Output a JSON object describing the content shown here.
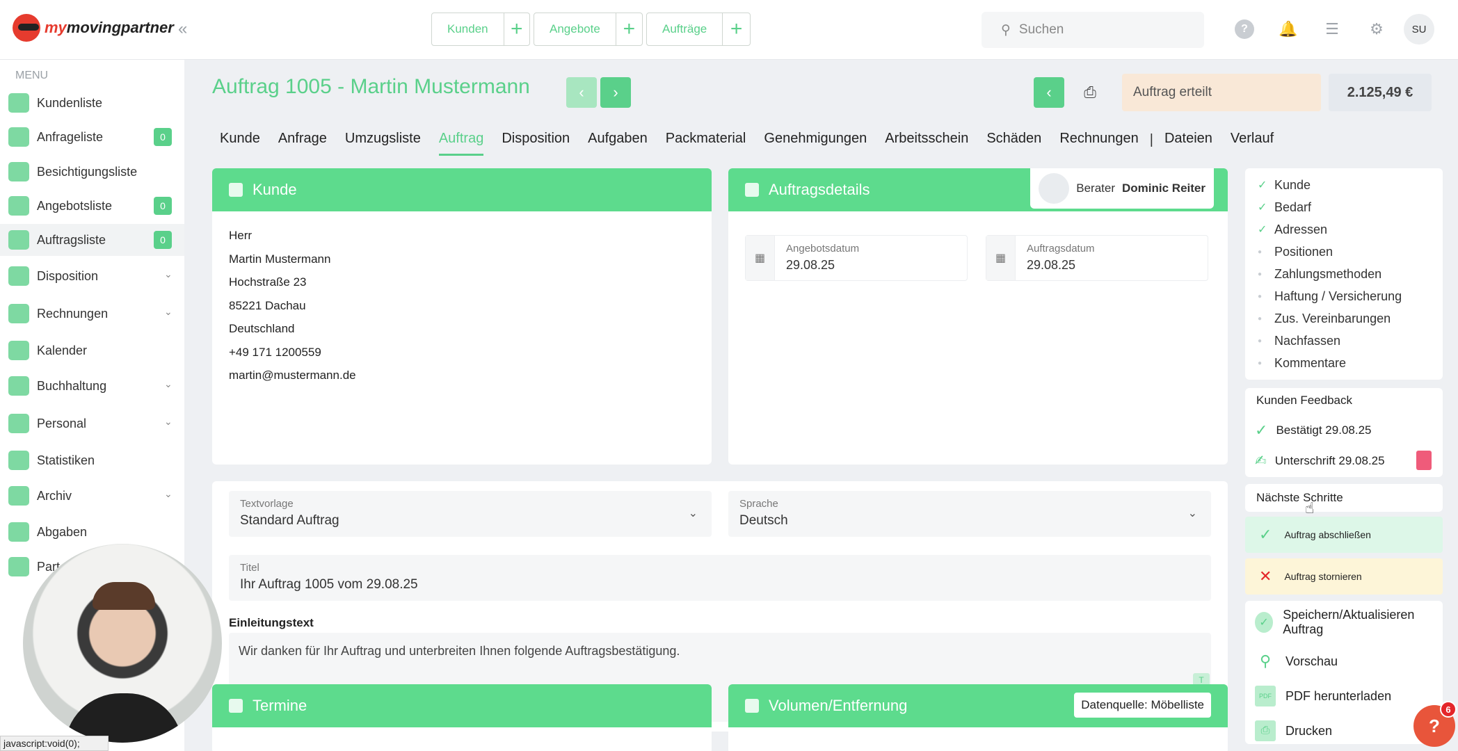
{
  "app": {
    "logo_text_a": "my",
    "logo_text_b": "movingpartner"
  },
  "quick": [
    {
      "label": "Kunden"
    },
    {
      "label": "Angebote"
    },
    {
      "label": "Aufträge"
    }
  ],
  "search": {
    "placeholder": "Suchen"
  },
  "user": {
    "initials": "SU"
  },
  "menu": {
    "heading": "MENU",
    "items": [
      {
        "label": "Kundenliste"
      },
      {
        "label": "Anfrageliste",
        "badge": "0"
      },
      {
        "label": "Besichtigungsliste"
      },
      {
        "label": "Angebotsliste",
        "badge": "0"
      },
      {
        "label": "Auftragsliste",
        "badge": "0"
      },
      {
        "label": "Disposition"
      },
      {
        "label": "Rechnungen"
      },
      {
        "label": "Kalender"
      },
      {
        "label": "Buchhaltung"
      },
      {
        "label": "Personal"
      },
      {
        "label": "Statistiken"
      },
      {
        "label": "Archiv"
      },
      {
        "label": "Abgaben"
      },
      {
        "label": "Part"
      }
    ]
  },
  "header": {
    "title": "Auftrag 1005 - Martin Mustermann",
    "status": "Auftrag erteilt",
    "amount": "2.125,49 €"
  },
  "tabs": [
    "Kunde",
    "Anfrage",
    "Umzugsliste",
    "Auftrag",
    "Disposition",
    "Aufgaben",
    "Packmaterial",
    "Genehmigungen",
    "Arbeitsschein",
    "Schäden",
    "Rechnungen",
    "Dateien",
    "Verlauf"
  ],
  "kunde": {
    "title": "Kunde",
    "lines": [
      "Herr",
      "Martin Mustermann",
      "Hochstraße 23",
      "85221 Dachau",
      "Deutschland",
      "+49 171 1200559",
      "martin@mustermann.de"
    ]
  },
  "details": {
    "title": "Auftragsdetails",
    "berater_label": "Berater",
    "berater_name": "Dominic Reiter",
    "angebotsdatum_label": "Angebotsdatum",
    "angebotsdatum": "29.08.25",
    "auftragsdatum_label": "Auftragsdatum",
    "auftragsdatum": "29.08.25"
  },
  "form": {
    "textvorlage_label": "Textvorlage",
    "textvorlage": "Standard Auftrag",
    "sprache_label": "Sprache",
    "sprache": "Deutsch",
    "titel_label": "Titel",
    "titel": "Ihr Auftrag 1005 vom 29.08.25",
    "einleitung_label": "Einleitungstext",
    "einleitung": "Wir danken für Ihr Auftrag und unterbreiten Ihnen folgende Auftragsbestätigung.",
    "t_icon": "T"
  },
  "termine": {
    "title": "Termine"
  },
  "volumen": {
    "title": "Volumen/Entfernung",
    "datenquelle": "Datenquelle: Möbelliste"
  },
  "checklist": [
    {
      "label": "Kunde",
      "done": true
    },
    {
      "label": "Bedarf",
      "done": true
    },
    {
      "label": "Adressen",
      "done": true
    },
    {
      "label": "Positionen",
      "done": false
    },
    {
      "label": "Zahlungsmethoden",
      "done": false
    },
    {
      "label": "Haftung / Versicherung",
      "done": false
    },
    {
      "label": "Zus. Vereinbarungen",
      "done": false
    },
    {
      "label": "Nachfassen",
      "done": false
    },
    {
      "label": "Kommentare",
      "done": false
    }
  ],
  "feedback": {
    "title": "Kunden Feedback",
    "bestaetigt": "Bestätigt 29.08.25",
    "unterschrift": "Unterschrift 29.08.25"
  },
  "next": {
    "title": "Nächste Schritte",
    "abschliessen": "Auftrag abschließen",
    "stornieren": "Auftrag stornieren"
  },
  "actions": {
    "save": "Speichern/Aktualisieren Auftrag",
    "preview": "Vorschau",
    "pdf": "PDF herunterladen",
    "print": "Drucken"
  },
  "statusbar": "javascript:void(0);",
  "help": {
    "icon": "?",
    "count": "6"
  },
  "colors": {
    "accent": "#5ad08a",
    "status_bg": "#f9e8d7",
    "danger": "#e4262a"
  }
}
